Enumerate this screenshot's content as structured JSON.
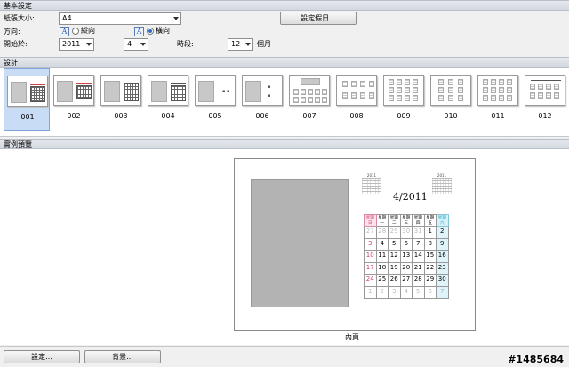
{
  "basic": {
    "header": "基本設定",
    "paper_size_label": "紙張大小:",
    "paper_size_value": "A4",
    "holiday_button": "設定假日...",
    "orientation_label": "方向:",
    "portrait_label": "縱向",
    "landscape_label": "橫向",
    "orientation_selected": "landscape",
    "start_label": "開始於:",
    "start_year": "2011",
    "start_month": "4",
    "duration_label": "時段:",
    "duration_value": "12",
    "duration_unit": "個月"
  },
  "design": {
    "header": "設計",
    "selected": "001",
    "items": [
      "001",
      "002",
      "003",
      "004",
      "005",
      "006",
      "007",
      "008",
      "009",
      "010",
      "011",
      "012"
    ]
  },
  "preview": {
    "header": "實例預覽",
    "calendar_title": "4/2011",
    "prev_month_title": "2011",
    "next_month_title": "2011",
    "weekday_headers": [
      "星期日",
      "星期一",
      "星期二",
      "星期三",
      "星期四",
      "星期五",
      "星期六"
    ],
    "weeks": [
      [
        "27",
        "28",
        "29",
        "30",
        "31",
        "1",
        "2"
      ],
      [
        "3",
        "4",
        "5",
        "6",
        "7",
        "8",
        "9"
      ],
      [
        "10",
        "11",
        "12",
        "13",
        "14",
        "15",
        "16"
      ],
      [
        "17",
        "18",
        "19",
        "20",
        "21",
        "22",
        "23"
      ],
      [
        "24",
        "25",
        "26",
        "27",
        "28",
        "29",
        "30"
      ],
      [
        "1",
        "2",
        "3",
        "4",
        "5",
        "6",
        "7"
      ]
    ],
    "page_caption": "內頁"
  },
  "footer": {
    "settings_button": "設定...",
    "background_button": "背景..."
  },
  "watermark": "#1485684"
}
